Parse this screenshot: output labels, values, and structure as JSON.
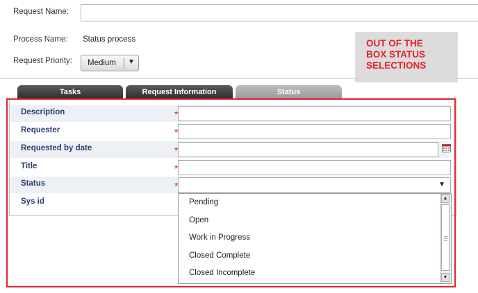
{
  "form": {
    "request_name_label": "Request Name:",
    "request_name_value": "",
    "process_name_label": "Process Name:",
    "process_name_value": "Status process",
    "priority_label": "Request Priority:",
    "priority_value": "Medium"
  },
  "callout": {
    "line1": "OUT OF THE",
    "line2": "BOX STATUS",
    "line3": "SELECTIONS",
    "color": "#e8202a"
  },
  "tabs": [
    {
      "label": "Tasks",
      "active": false
    },
    {
      "label": "Request Information",
      "active": false
    },
    {
      "label": "Status",
      "active": true
    }
  ],
  "fields": [
    {
      "label": "Description",
      "required": true
    },
    {
      "label": "Requester",
      "required": true
    },
    {
      "label": "Requested by date",
      "required": true
    },
    {
      "label": "Title",
      "required": true
    },
    {
      "label": "Status",
      "required": true
    },
    {
      "label": "Sys id",
      "required": false
    }
  ],
  "required_mark": "*",
  "status_options": [
    "Pending",
    "Open",
    "Work in Progress",
    "Closed Complete",
    "Closed Incomplete"
  ],
  "icons": {
    "select_arrow": "chevron-down-icon",
    "calendar": "calendar-icon",
    "scroll_up": "scroll-up-icon",
    "scroll_down": "scroll-down-icon"
  }
}
